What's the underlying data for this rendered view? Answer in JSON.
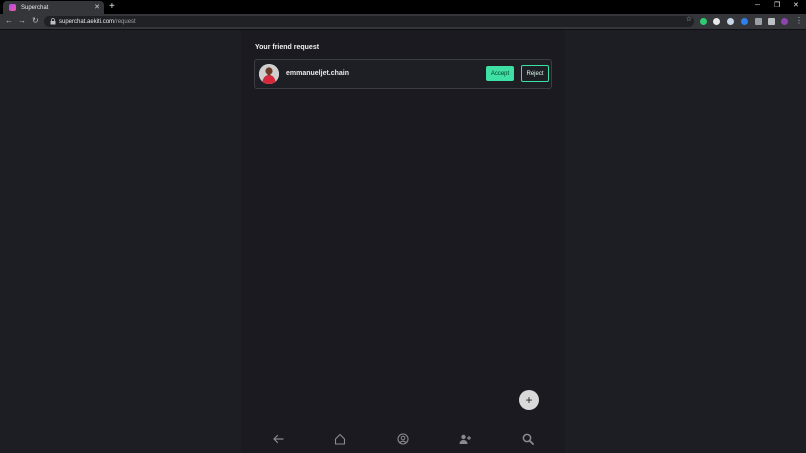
{
  "browser": {
    "tab_title": "Superchat",
    "url_host": "superchat.aekiti.com",
    "url_path": "/request",
    "colors": {
      "chrome": "#35363a",
      "tabstrip": "#000000"
    }
  },
  "page": {
    "section_title": "Your friend request",
    "requests": [
      {
        "username": "emmanueljet.chain",
        "accept_label": "Accept",
        "reject_label": "Reject"
      }
    ],
    "fab_label": "+",
    "bottom_nav": [
      "back-arrow-icon",
      "home-icon",
      "profile-icon",
      "add-friend-icon",
      "search-icon"
    ],
    "colors": {
      "background": "#1d1d24",
      "accent": "#3ee0a3"
    }
  }
}
